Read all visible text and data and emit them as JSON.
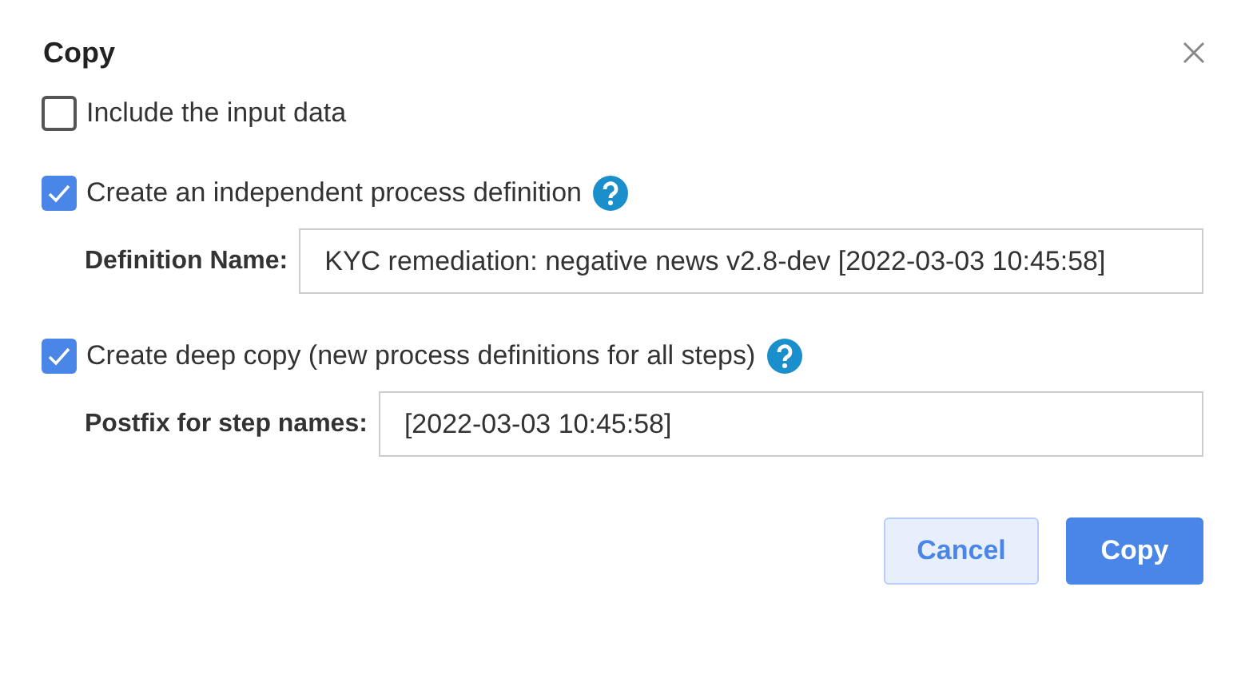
{
  "dialog": {
    "title": "Copy"
  },
  "options": [
    {
      "label": "Include the input data",
      "checked": false,
      "help": false
    },
    {
      "label": "Create an independent process definition",
      "checked": true,
      "help": true,
      "field": {
        "label": "Definition Name:",
        "value": "KYC remediation: negative news v2.8-dev [2022-03-03 10:45:58]"
      }
    },
    {
      "label": "Create deep copy (new process definitions for all steps)",
      "checked": true,
      "help": true,
      "field": {
        "label": "Postfix for step names:",
        "value": "[2022-03-03 10:45:58]"
      }
    }
  ],
  "buttons": [
    {
      "label": "Cancel",
      "kind": "secondary"
    },
    {
      "label": "Copy",
      "kind": "primary"
    }
  ]
}
